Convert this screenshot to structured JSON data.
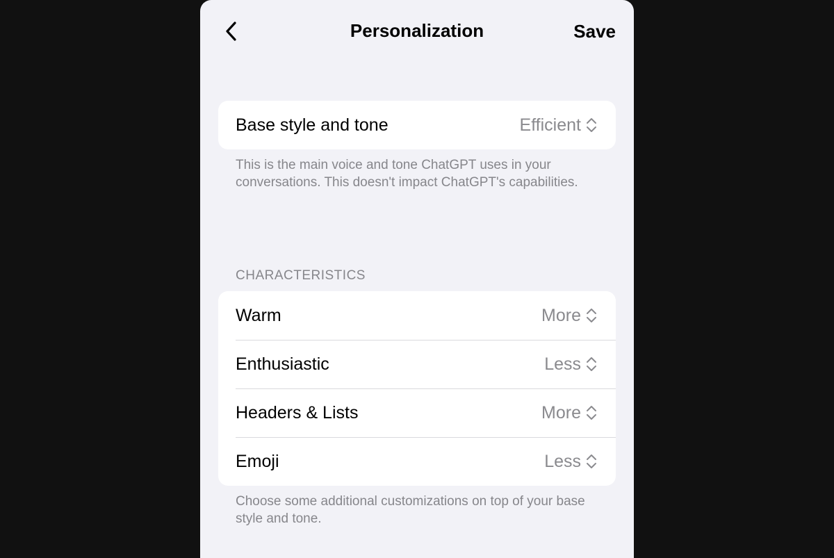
{
  "nav": {
    "title": "Personalization",
    "save_label": "Save"
  },
  "base_style": {
    "label": "Base style and tone",
    "value": "Efficient",
    "footnote": "This is the main voice and tone ChatGPT uses in your conversations. This doesn't impact ChatGPT's capabilities."
  },
  "characteristics": {
    "header": "CHARACTERISTICS",
    "items": [
      {
        "label": "Warm",
        "value": "More"
      },
      {
        "label": "Enthusiastic",
        "value": "Less"
      },
      {
        "label": "Headers & Lists",
        "value": "More"
      },
      {
        "label": "Emoji",
        "value": "Less"
      }
    ],
    "footnote": "Choose some additional customizations on top of your base style and tone."
  },
  "icons": {
    "back": "chevron-left-icon",
    "selector": "chevron-up-down-icon"
  },
  "colors": {
    "background": "#f2f2f7",
    "card": "#ffffff",
    "secondary_text": "#8a8a8e",
    "outer_background": "#111111"
  }
}
